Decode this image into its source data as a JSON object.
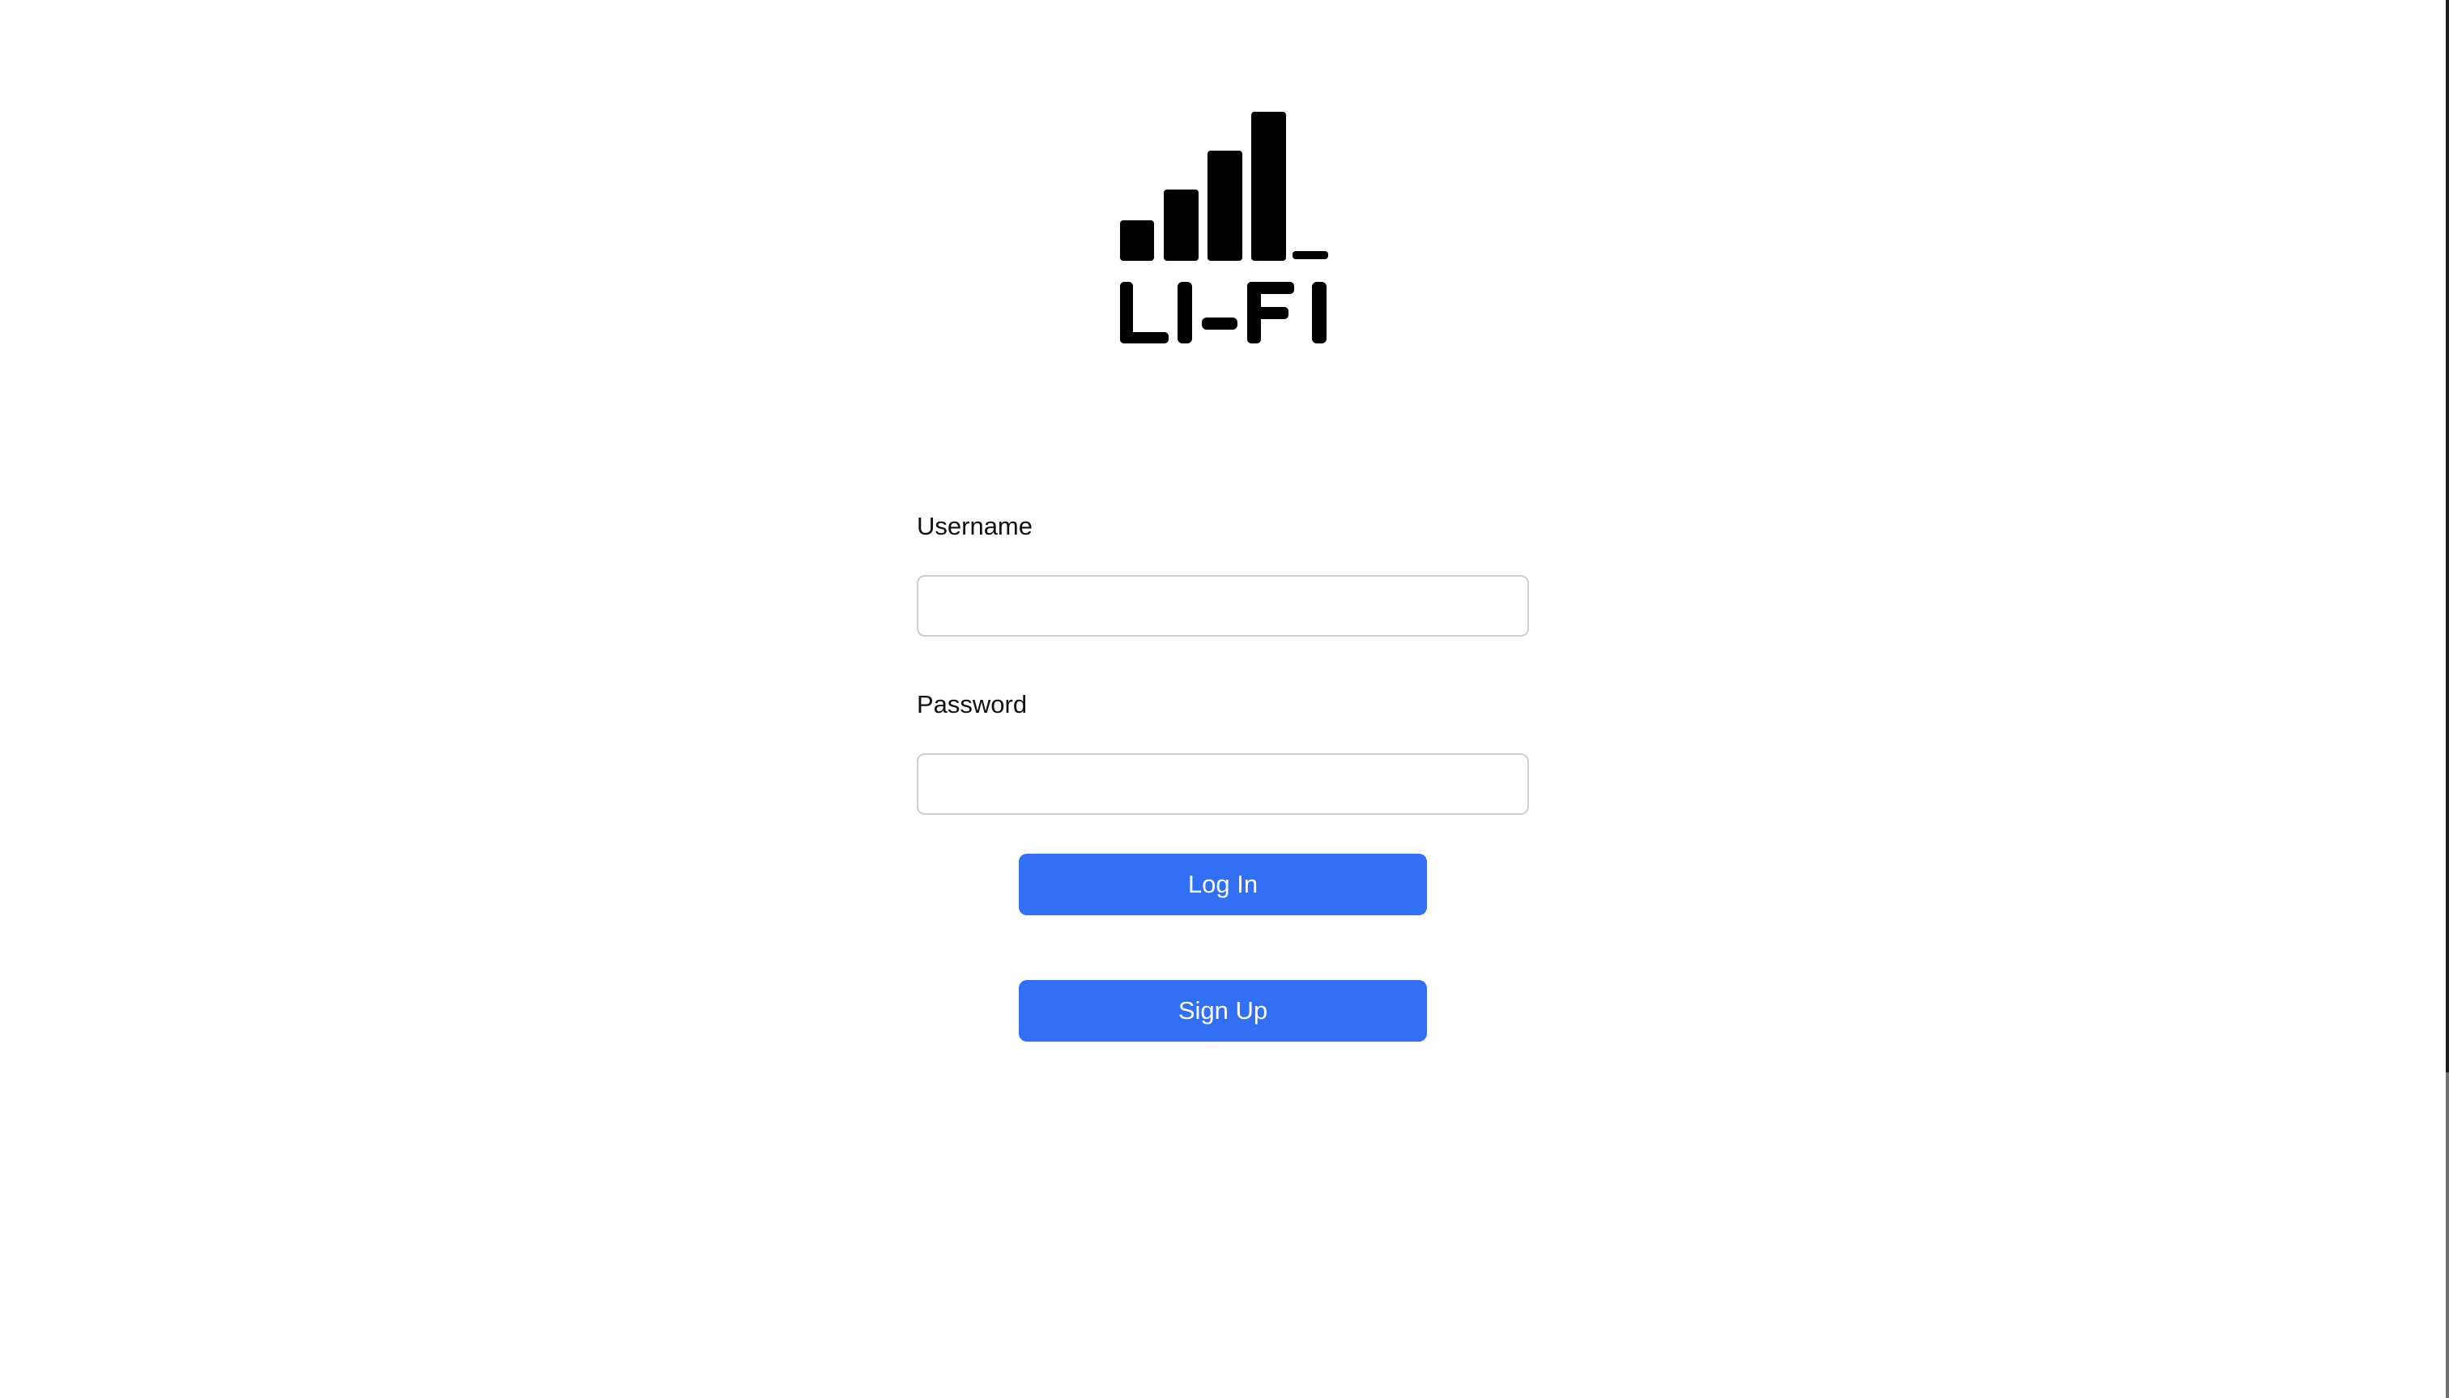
{
  "brand": {
    "logo_text": "LI-FI",
    "logo_icon": "signal-bars-icon",
    "logo_color": "#000000"
  },
  "login_form": {
    "username_label": "Username",
    "username_value": "",
    "password_label": "Password",
    "password_value": "",
    "login_button_label": "Log In",
    "signup_button_label": "Sign Up"
  },
  "colors": {
    "primary_button": "#316ff4",
    "button_text": "#ffffff",
    "input_border": "#cfcfcf",
    "background": "#ffffff"
  }
}
